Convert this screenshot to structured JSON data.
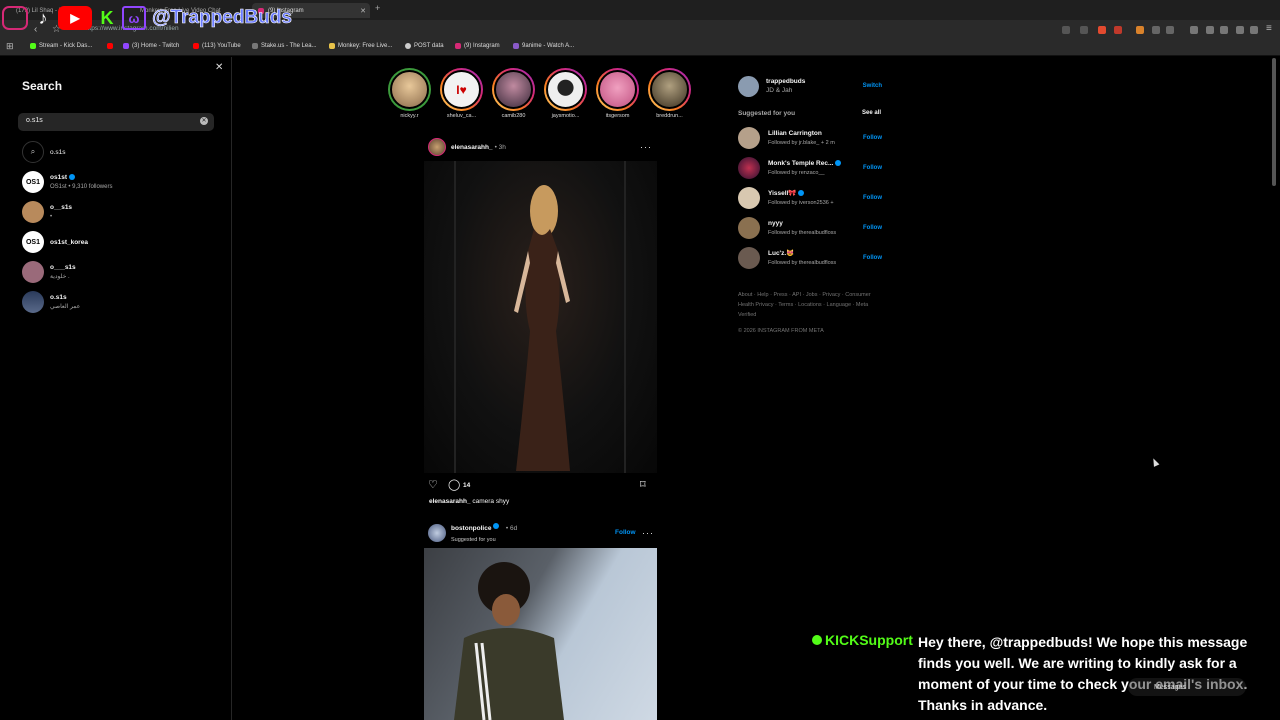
{
  "browser": {
    "tabs": [
      {
        "label": "(179) Lil Shaq - L...",
        "active": false
      },
      {
        "label": "Monkey: Free Live Video Chat",
        "active": false
      },
      {
        "label": "(9) Instagram",
        "active": true
      }
    ],
    "url": "https://www.instagram.com/nilien",
    "bookmarks": [
      "Stream - Kick Das...",
      "(3) Home - Twitch",
      "(113) YouTube",
      "Stake.us - The Lea...",
      "Monkey: Free Live...",
      "POST data",
      "(9) Instagram",
      "9anime - Watch A..."
    ]
  },
  "overlay": {
    "handle": "@TrappedBuds",
    "colors": {
      "kick": "#53fc18",
      "youtube": "#ff0000",
      "twitch": "#9146ff"
    }
  },
  "search": {
    "title": "Search",
    "query": "o.s1s",
    "suggestion": "o.s1s",
    "results": [
      {
        "username": "os1st",
        "subtitle": "OS1st • 9,310 followers",
        "verified": true,
        "avatar_text": "OS1",
        "avatar_color": "#ffffff"
      },
      {
        "username": "o__s1s",
        "subtitle": "•",
        "verified": false,
        "avatar_text": "",
        "avatar_color": "#b88a5c"
      },
      {
        "username": "os1st_korea",
        "subtitle": "",
        "verified": false,
        "avatar_text": "OS1",
        "avatar_color": "#ffffff"
      },
      {
        "username": "o___s1s",
        "subtitle": "خلودية .",
        "verified": false,
        "avatar_text": "",
        "avatar_color": "#9a6a7a"
      },
      {
        "username": "o.s1s",
        "subtitle": "عمر العاصي",
        "verified": false,
        "avatar_text": "",
        "avatar_color": "#3a4a6a"
      }
    ]
  },
  "stories": [
    {
      "name": "nickyy.r",
      "seen": true,
      "color": "#d8b27c"
    },
    {
      "name": "sheluv_ca...",
      "seen": false,
      "color": "#f0f0f0"
    },
    {
      "name": "camib280",
      "seen": false,
      "color": "#8a5a7a"
    },
    {
      "name": "jaysmotio...",
      "seen": false,
      "color": "#e8e8e8"
    },
    {
      "name": "itsgersom",
      "seen": false,
      "color": "#e07aa0"
    },
    {
      "name": "breddrun...",
      "seen": false,
      "color": "#6a5a3a"
    }
  ],
  "feed": {
    "post1": {
      "username": "elenasarahh_",
      "time": "3h",
      "comments": "14",
      "caption_user": "elenasarahh_",
      "caption_text": "camera shyy"
    },
    "post2": {
      "username": "bostonpolice",
      "time": "6d",
      "subtitle": "Suggested for you",
      "follow": "Follow",
      "verified": true
    }
  },
  "sidebar": {
    "me": {
      "username": "trappedbuds",
      "fullname": "JD & Jah",
      "switch": "Switch"
    },
    "suggested_title": "Suggested for you",
    "see_all": "See all",
    "suggestions": [
      {
        "name": "Lillian Carrington",
        "sub": "Followed by jr.blake_ + 2 m",
        "follow": "Follow",
        "color": "#b5a08a"
      },
      {
        "name": "Monk's Temple Rec...",
        "sub": "Followed by renzaco__",
        "follow": "Follow",
        "color": "#c03050",
        "verified": true
      },
      {
        "name": "Yissell🎀",
        "sub": "Followed by iverson2536 +",
        "follow": "Follow",
        "color": "#d8c8b0",
        "verified": true
      },
      {
        "name": "nyyy",
        "sub": "Followed by therealbudfloss",
        "follow": "Follow",
        "color": "#8a7050"
      },
      {
        "name": "Luc'z.😻",
        "sub": "Followed by therealbudfloss",
        "follow": "Follow",
        "color": "#6a5a50"
      }
    ],
    "footer": "About · Help · Press · API · Jobs · Privacy · Consumer Health Privacy · Terms · Locations · Language · Meta Verified",
    "copyright": "© 2026 INSTAGRAM FROM META"
  },
  "chat": {
    "user": "KICKSupport",
    "message": "Hey there, @trappedbuds! We hope this message finds you well. We are writing to kindly ask for a moment of your time to check your email's inbox. Thanks in advance.",
    "messages_pill": "Messages"
  }
}
